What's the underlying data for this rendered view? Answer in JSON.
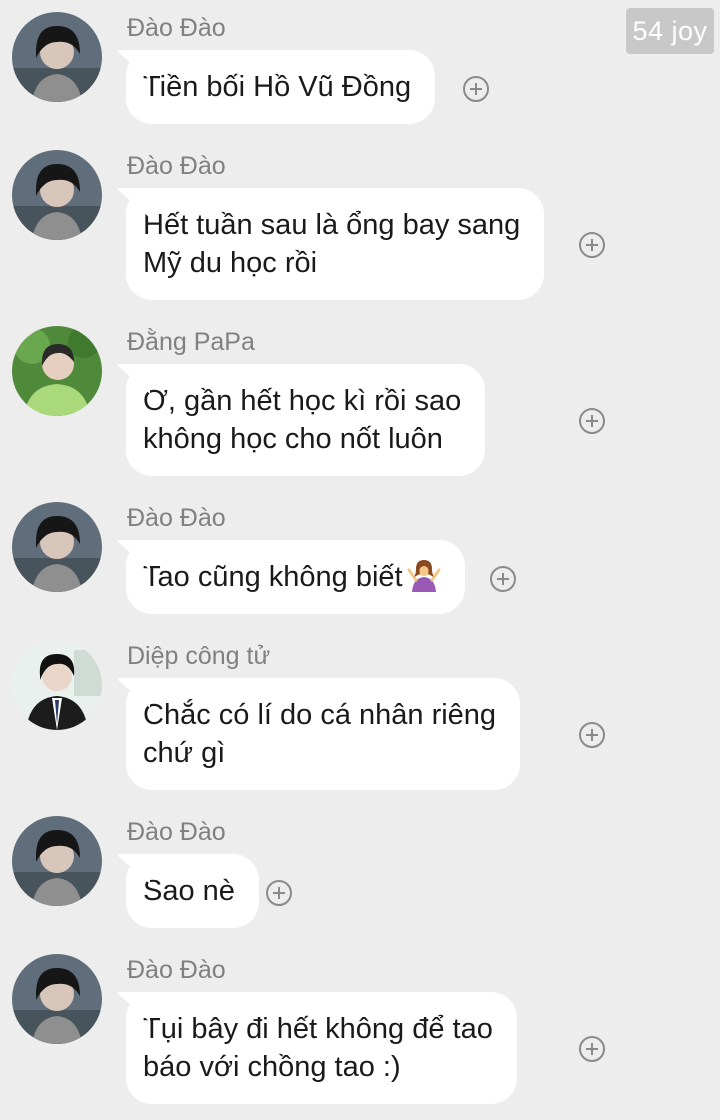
{
  "watermark": "54 joy",
  "messages": [
    {
      "sender": "Đào Đào",
      "text": "Tiền bối Hồ Vũ Đồng",
      "avatar": "dao-dao"
    },
    {
      "sender": "Đào Đào",
      "text": "Hết tuần sau là ổng bay sang\nMỹ du học rồi",
      "avatar": "dao-dao"
    },
    {
      "sender": "Đằng PaPa",
      "text": "Ơ, gần hết học kì rồi sao\nkhông học cho nốt luôn",
      "avatar": "dang-papa"
    },
    {
      "sender": "Đào Đào",
      "text": "Tao cũng không biết",
      "emoji": "person-shrugging",
      "avatar": "dao-dao"
    },
    {
      "sender": "Diệp công tử",
      "text": "Chắc có lí do cá nhân riêng\nchứ gì",
      "avatar": "diep-cong-tu"
    },
    {
      "sender": "Đào Đào",
      "text": "Sao nè",
      "avatar": "dao-dao"
    },
    {
      "sender": "Đào Đào",
      "text": "Tụi bây đi hết không để tao\nbáo với chồng tao :)",
      "avatar": "dao-dao"
    }
  ]
}
